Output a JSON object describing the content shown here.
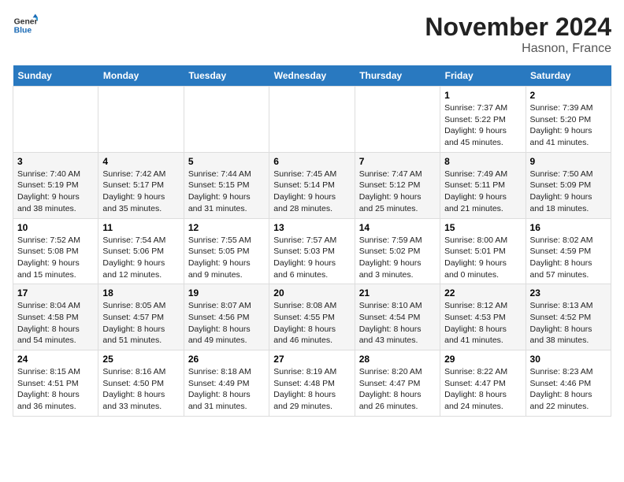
{
  "logo": {
    "line1": "General",
    "line2": "Blue"
  },
  "title": "November 2024",
  "subtitle": "Hasnon, France",
  "days_of_week": [
    "Sunday",
    "Monday",
    "Tuesday",
    "Wednesday",
    "Thursday",
    "Friday",
    "Saturday"
  ],
  "weeks": [
    [
      {
        "day": "",
        "info": ""
      },
      {
        "day": "",
        "info": ""
      },
      {
        "day": "",
        "info": ""
      },
      {
        "day": "",
        "info": ""
      },
      {
        "day": "",
        "info": ""
      },
      {
        "day": "1",
        "info": "Sunrise: 7:37 AM\nSunset: 5:22 PM\nDaylight: 9 hours and 45 minutes."
      },
      {
        "day": "2",
        "info": "Sunrise: 7:39 AM\nSunset: 5:20 PM\nDaylight: 9 hours and 41 minutes."
      }
    ],
    [
      {
        "day": "3",
        "info": "Sunrise: 7:40 AM\nSunset: 5:19 PM\nDaylight: 9 hours and 38 minutes."
      },
      {
        "day": "4",
        "info": "Sunrise: 7:42 AM\nSunset: 5:17 PM\nDaylight: 9 hours and 35 minutes."
      },
      {
        "day": "5",
        "info": "Sunrise: 7:44 AM\nSunset: 5:15 PM\nDaylight: 9 hours and 31 minutes."
      },
      {
        "day": "6",
        "info": "Sunrise: 7:45 AM\nSunset: 5:14 PM\nDaylight: 9 hours and 28 minutes."
      },
      {
        "day": "7",
        "info": "Sunrise: 7:47 AM\nSunset: 5:12 PM\nDaylight: 9 hours and 25 minutes."
      },
      {
        "day": "8",
        "info": "Sunrise: 7:49 AM\nSunset: 5:11 PM\nDaylight: 9 hours and 21 minutes."
      },
      {
        "day": "9",
        "info": "Sunrise: 7:50 AM\nSunset: 5:09 PM\nDaylight: 9 hours and 18 minutes."
      }
    ],
    [
      {
        "day": "10",
        "info": "Sunrise: 7:52 AM\nSunset: 5:08 PM\nDaylight: 9 hours and 15 minutes."
      },
      {
        "day": "11",
        "info": "Sunrise: 7:54 AM\nSunset: 5:06 PM\nDaylight: 9 hours and 12 minutes."
      },
      {
        "day": "12",
        "info": "Sunrise: 7:55 AM\nSunset: 5:05 PM\nDaylight: 9 hours and 9 minutes."
      },
      {
        "day": "13",
        "info": "Sunrise: 7:57 AM\nSunset: 5:03 PM\nDaylight: 9 hours and 6 minutes."
      },
      {
        "day": "14",
        "info": "Sunrise: 7:59 AM\nSunset: 5:02 PM\nDaylight: 9 hours and 3 minutes."
      },
      {
        "day": "15",
        "info": "Sunrise: 8:00 AM\nSunset: 5:01 PM\nDaylight: 9 hours and 0 minutes."
      },
      {
        "day": "16",
        "info": "Sunrise: 8:02 AM\nSunset: 4:59 PM\nDaylight: 8 hours and 57 minutes."
      }
    ],
    [
      {
        "day": "17",
        "info": "Sunrise: 8:04 AM\nSunset: 4:58 PM\nDaylight: 8 hours and 54 minutes."
      },
      {
        "day": "18",
        "info": "Sunrise: 8:05 AM\nSunset: 4:57 PM\nDaylight: 8 hours and 51 minutes."
      },
      {
        "day": "19",
        "info": "Sunrise: 8:07 AM\nSunset: 4:56 PM\nDaylight: 8 hours and 49 minutes."
      },
      {
        "day": "20",
        "info": "Sunrise: 8:08 AM\nSunset: 4:55 PM\nDaylight: 8 hours and 46 minutes."
      },
      {
        "day": "21",
        "info": "Sunrise: 8:10 AM\nSunset: 4:54 PM\nDaylight: 8 hours and 43 minutes."
      },
      {
        "day": "22",
        "info": "Sunrise: 8:12 AM\nSunset: 4:53 PM\nDaylight: 8 hours and 41 minutes."
      },
      {
        "day": "23",
        "info": "Sunrise: 8:13 AM\nSunset: 4:52 PM\nDaylight: 8 hours and 38 minutes."
      }
    ],
    [
      {
        "day": "24",
        "info": "Sunrise: 8:15 AM\nSunset: 4:51 PM\nDaylight: 8 hours and 36 minutes."
      },
      {
        "day": "25",
        "info": "Sunrise: 8:16 AM\nSunset: 4:50 PM\nDaylight: 8 hours and 33 minutes."
      },
      {
        "day": "26",
        "info": "Sunrise: 8:18 AM\nSunset: 4:49 PM\nDaylight: 8 hours and 31 minutes."
      },
      {
        "day": "27",
        "info": "Sunrise: 8:19 AM\nSunset: 4:48 PM\nDaylight: 8 hours and 29 minutes."
      },
      {
        "day": "28",
        "info": "Sunrise: 8:20 AM\nSunset: 4:47 PM\nDaylight: 8 hours and 26 minutes."
      },
      {
        "day": "29",
        "info": "Sunrise: 8:22 AM\nSunset: 4:47 PM\nDaylight: 8 hours and 24 minutes."
      },
      {
        "day": "30",
        "info": "Sunrise: 8:23 AM\nSunset: 4:46 PM\nDaylight: 8 hours and 22 minutes."
      }
    ]
  ]
}
